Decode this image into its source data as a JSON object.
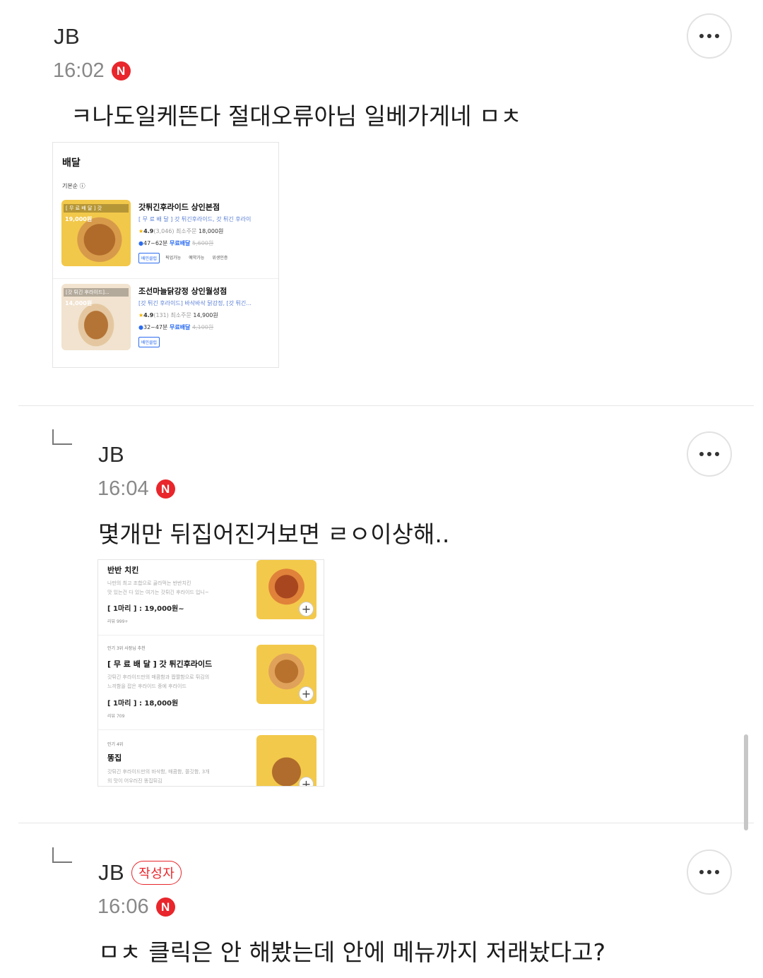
{
  "comments": [
    {
      "author": "JB",
      "time": "16:02",
      "new_badge": "N",
      "text": "ㅋ나도일케뜬다 절대오류아님 일베가게네 ㅁㅊ",
      "more_icon": "more-horizontal-icon"
    },
    {
      "author": "JB",
      "time": "16:04",
      "new_badge": "N",
      "text": "몇개만 뒤집어진거보면 ㄹㅇ이상해..",
      "more_icon": "more-horizontal-icon"
    },
    {
      "author": "JB",
      "author_badge": "작성자",
      "time": "16:06",
      "new_badge": "N",
      "text": "ㅁㅊ 클릭은 안 해봤는데 안에 메뉴까지 저래놨다고?",
      "more_icon": "more-horizontal-icon"
    }
  ],
  "delivery_shot": {
    "title": "배달",
    "sort": "기본순 ⓘ",
    "stores": [
      {
        "thumb_tag": "[ 무 료 배 달 ] 갓",
        "thumb_price": "19,000원",
        "name": "갓튀긴후라이드 상인본점",
        "desc": "[ 무 료 배 달 ] 갓 튀긴후라이드, 갓 튀긴 후라이",
        "rating": "4.9",
        "reviews": "(3,046)",
        "min_order_label": "최소주문",
        "min_order": "18,000원",
        "delivery_time": "47~62분",
        "free_label": "무료배달",
        "old_fee": "5,600원",
        "chips": [
          "배민클럽",
          "픽업가능",
          "예약가능",
          "위생인증"
        ]
      },
      {
        "thumb_tag": "[갓 튀긴 후라이드]...",
        "thumb_price": "14,000원",
        "name": "조선마늘닭강정 상인월성점",
        "desc": "[갓 튀긴 후라이드] 바삭바삭 닭강정, [갓 튀긴...",
        "rating": "4.9",
        "reviews": "(131)",
        "min_order_label": "최소주문",
        "min_order": "14,900원",
        "delivery_time": "32~47분",
        "free_label": "무료배달",
        "old_fee": "4,100원",
        "chips": [
          "배민클럽"
        ]
      }
    ]
  },
  "menu_shot": {
    "items": [
      {
        "tags": "",
        "name": "반반 치킨",
        "desc1": "나만의 최고 조합으로 골라먹는 반반치킨",
        "desc2": "맛 있는건 다 있는 여기는 갓튀긴 후라이드 입니~",
        "price": "[ 1마리 ] : 19,000원~",
        "reviews": "리뷰 999+"
      },
      {
        "tags": "인기 3위   사장님 추천",
        "name": "[ 무 료 배 달 ] 갓 튀긴후라이드",
        "desc1": "갓튀긴 후라이드만의 매콤함과 짭짤함으로 튀김의",
        "desc2": "느끼함을 잡은 후라이드 중에 후라이드",
        "price": "[ 1마리 ] : 18,000원",
        "reviews": "리뷰 709"
      },
      {
        "tags": "인기 4위",
        "name": "똥집",
        "desc1": "갓튀긴 후라이드만의 바삭함, 매콤함, 쫄깃함, 3개",
        "desc2": "의 맛이 어우러진 똥집튀김",
        "price": "",
        "reviews": ""
      }
    ],
    "add_symbol": "+"
  }
}
